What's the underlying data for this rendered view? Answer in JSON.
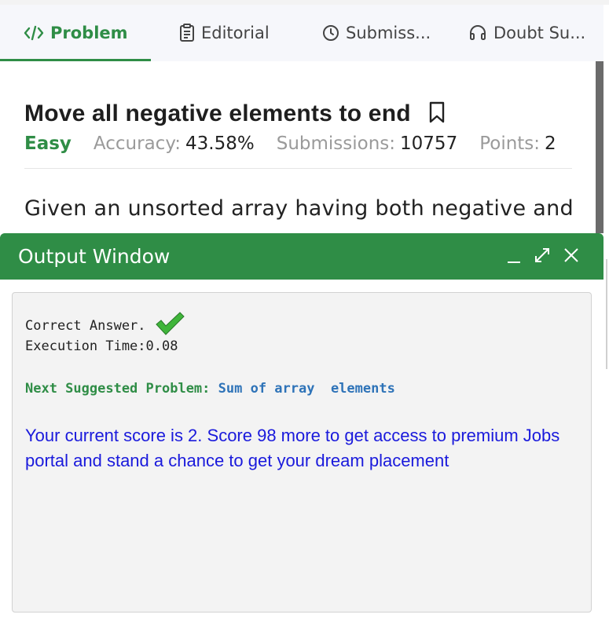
{
  "tabs": [
    {
      "label": "Problem",
      "icon": "code-icon",
      "active": true
    },
    {
      "label": "Editorial",
      "icon": "document-icon",
      "active": false
    },
    {
      "label": "Submiss...",
      "icon": "clock-icon",
      "active": false
    },
    {
      "label": "Doubt Su...",
      "icon": "headset-icon",
      "active": false
    }
  ],
  "problem": {
    "title": "Move all negative elements to end",
    "difficulty": "Easy",
    "accuracy_label": "Accuracy:",
    "accuracy_value": "43.58%",
    "submissions_label": "Submissions:",
    "submissions_value": "10757",
    "points_label": "Points:",
    "points_value": "2",
    "description": "Given an unsorted array having both negative and"
  },
  "output_window": {
    "title": "Output Window",
    "result": "Correct Answer.",
    "execution_time": "Execution Time:0.08",
    "next_label": "Next Suggested Problem:",
    "next_problem": "Sum of array  elements",
    "score_message": "Your current score is 2. Score 98 more to get access to premium Jobs portal and stand a chance to get your dream placement"
  },
  "colors": {
    "accent_green": "#2f8d46",
    "link_blue": "#2e73b8",
    "score_blue": "#1a1adc"
  }
}
